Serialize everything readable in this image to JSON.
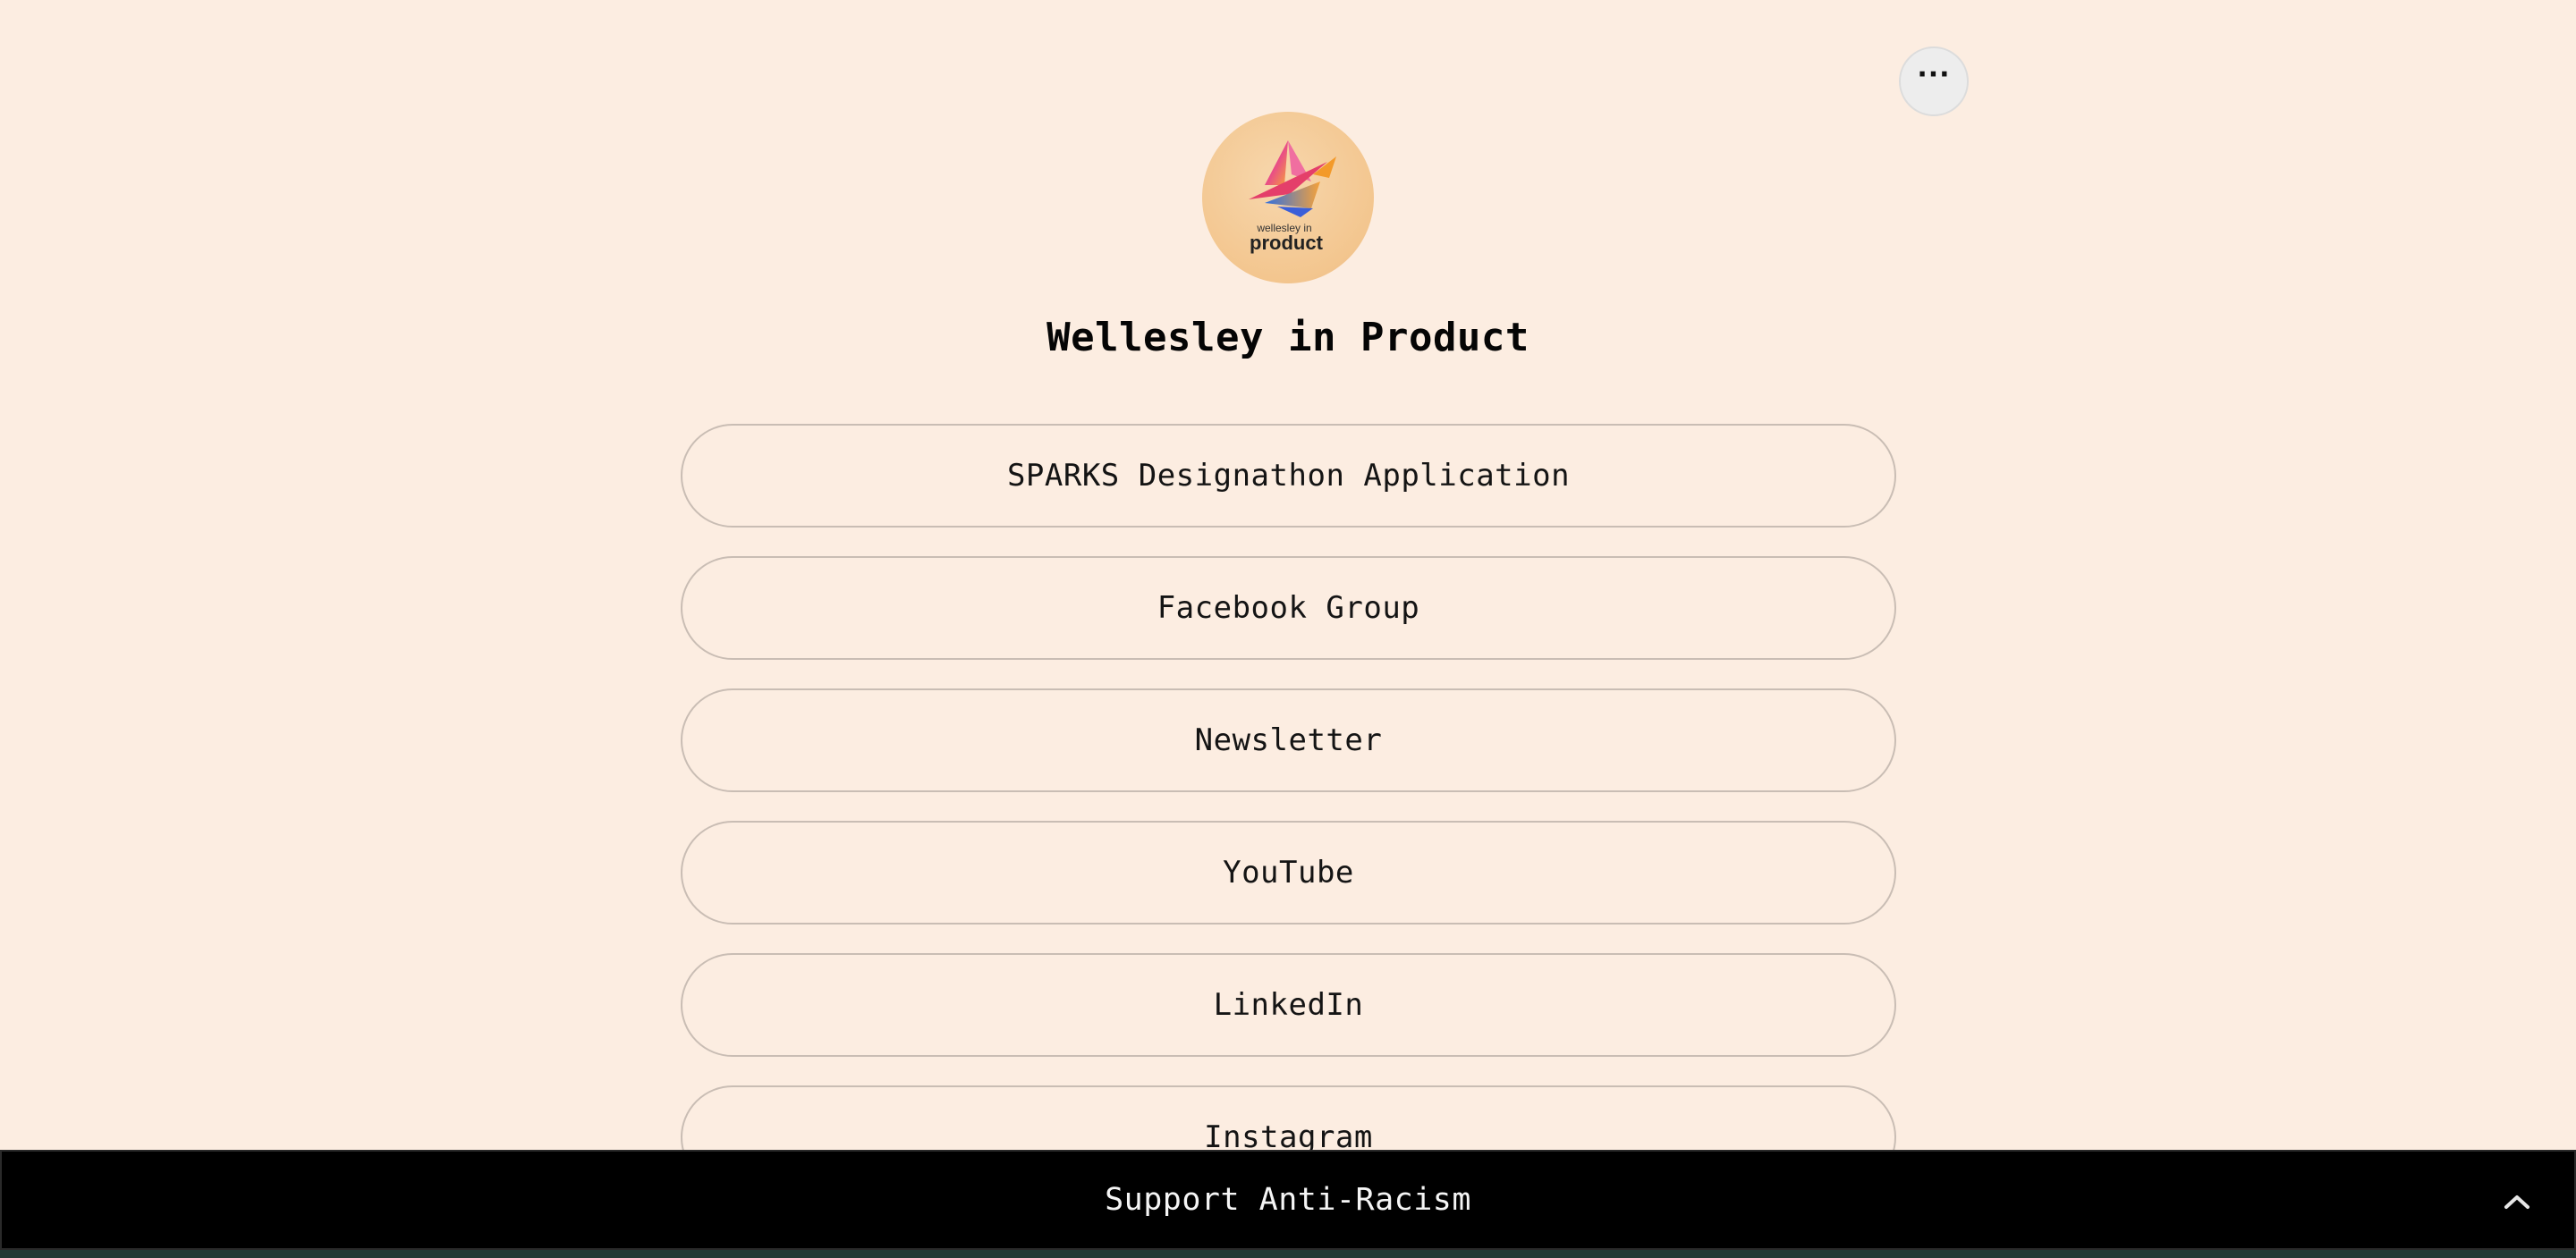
{
  "header": {
    "more_button_icon": "ellipsis-icon",
    "more_button_label": "···"
  },
  "profile": {
    "avatar_logo": {
      "icon": "wellesley-in-product-logo",
      "line1": "wellesley in",
      "line2": "product"
    },
    "title": "Wellesley in Product"
  },
  "links": [
    {
      "label": "SPARKS Designathon Application"
    },
    {
      "label": "Facebook Group"
    },
    {
      "label": "Newsletter"
    },
    {
      "label": "YouTube"
    },
    {
      "label": "LinkedIn"
    },
    {
      "label": "Instagram"
    }
  ],
  "banner": {
    "text": "Support Anti-Racism",
    "toggle_icon": "chevron-up-icon"
  },
  "colors": {
    "background": "#fcede1",
    "banner_background": "#000000",
    "button_border": "#c9bdb4"
  }
}
